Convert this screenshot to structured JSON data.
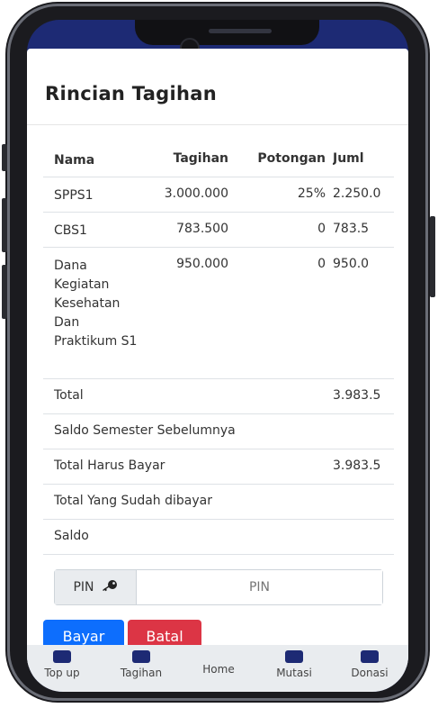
{
  "modal": {
    "title": "Rincian Tagihan"
  },
  "table": {
    "headers": {
      "nama": "Nama",
      "tagihan": "Tagihan",
      "potongan": "Potongan",
      "jumlah": "Juml"
    },
    "rows": [
      {
        "nama": "SPPS1",
        "tagihan": "3.000.000",
        "potongan": "25%",
        "jumlah": "2.250.0"
      },
      {
        "nama": "CBS1",
        "tagihan": "783.500",
        "potongan": "0",
        "jumlah": "783.5"
      },
      {
        "nama": "Dana Kegiatan Kesehatan Dan Praktikum S1",
        "tagihan": "950.000",
        "potongan": "0",
        "jumlah": "950.0"
      }
    ],
    "summary": {
      "total_label": "Total",
      "total_value": "3.983.5",
      "saldo_semester_label": "Saldo Semester Sebelumnya",
      "total_harus_label": "Total Harus Bayar",
      "total_harus_value": "3.983.5",
      "total_sudah_label": "Total Yang Sudah dibayar",
      "saldo_label": "Saldo"
    }
  },
  "pin": {
    "label": "PIN",
    "placeholder": "PIN",
    "icon": "key-icon"
  },
  "buttons": {
    "pay": "Bayar",
    "cancel": "Batal"
  },
  "bottom_nav": {
    "items": [
      "Top up",
      "Tagihan",
      "Home",
      "Mutasi",
      "Donasi"
    ]
  },
  "colors": {
    "primary": "#0d6efd",
    "danger": "#dc3545",
    "app_bar": "#1d2a74"
  }
}
